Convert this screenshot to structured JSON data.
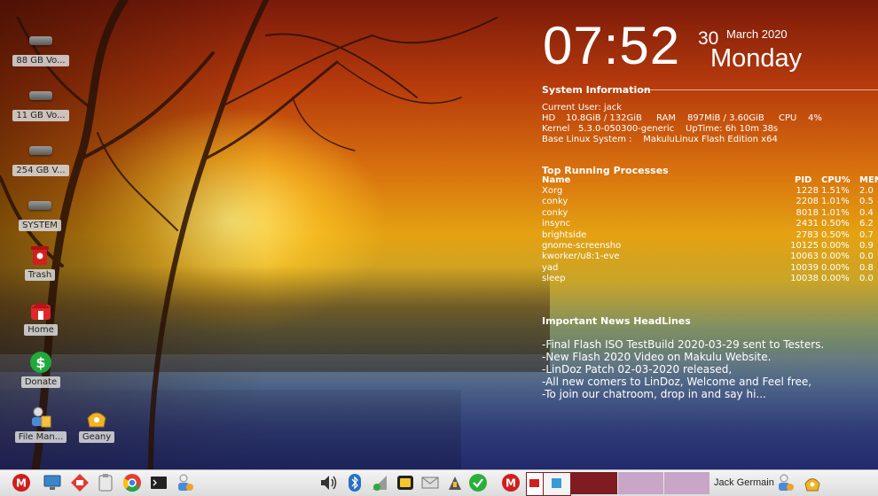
{
  "desktop": {
    "icons": [
      {
        "label": "88 GB Vo...",
        "icon": "drive-icon"
      },
      {
        "label": "11 GB Vo...",
        "icon": "drive-icon"
      },
      {
        "label": "254 GB V...",
        "icon": "drive-icon"
      },
      {
        "label": "SYSTEM",
        "icon": "drive-icon"
      },
      {
        "label": "Trash",
        "icon": "trash-icon"
      },
      {
        "label": "Home",
        "icon": "home-icon"
      },
      {
        "label": "Donate",
        "icon": "dollar-icon"
      },
      {
        "label": "File Man...",
        "icon": "file-manager-icon"
      },
      {
        "label": "Geany",
        "icon": "geany-icon"
      }
    ]
  },
  "conky": {
    "clock": {
      "time": "07:52",
      "day": "30",
      "month_year": "March 2020",
      "weekday": "Monday"
    },
    "system": {
      "title": "System Information",
      "user_line": "Current User: jack",
      "hd_label": "HD",
      "hd_value": "10.8GiB / 132GiB",
      "ram_label": "RAM",
      "ram_value": "897MiB / 3.60GiB",
      "cpu_label": "CPU",
      "cpu_value": "4%",
      "kernel_line": "Kernel   5.3.0-050300-generic",
      "uptime_line": "UpTime: 6h 10m 38s",
      "base_line": "Base Linux System :    MakuluLinux Flash Edition x64"
    },
    "processes": {
      "title": "Top Running Processes",
      "headers": {
        "name": "Name",
        "pid": "PID",
        "cpu": "CPU%",
        "mem": "MEM"
      },
      "rows": [
        {
          "name": "Xorg",
          "pid": "1228",
          "cpu": "1.51%",
          "mem": "2.0"
        },
        {
          "name": "conky",
          "pid": "2208",
          "cpu": "1.01%",
          "mem": "0.5"
        },
        {
          "name": "conky",
          "pid": "8018",
          "cpu": "1.01%",
          "mem": "0.4"
        },
        {
          "name": "insync",
          "pid": "2431",
          "cpu": "0.50%",
          "mem": "6.2"
        },
        {
          "name": "brightside",
          "pid": "2783",
          "cpu": "0.50%",
          "mem": "0.7"
        },
        {
          "name": "gnome-screensho",
          "pid": "10125",
          "cpu": "0.00%",
          "mem": "0.9"
        },
        {
          "name": "kworker/u8:1-eve",
          "pid": "10063",
          "cpu": "0.00%",
          "mem": "0.0"
        },
        {
          "name": "yad",
          "pid": "10039",
          "cpu": "0.00%",
          "mem": "0.8"
        },
        {
          "name": "sleep",
          "pid": "10038",
          "cpu": "0.00%",
          "mem": "0.0"
        }
      ]
    },
    "news": {
      "title": "Important News HeadLines",
      "items": [
        "-Final Flash ISO TestBuild 2020-03-29 sent to Testers.",
        "-New Flash 2020 Video on Makulu Website.",
        "-LinDoz Patch 02-03-2020 released,",
        "-All new comers to LinDoz, Welcome and Feel free,",
        "-To join our chatroom, drop in and say hi..."
      ]
    }
  },
  "taskbar": {
    "username": "Jack Germain",
    "launchers": [
      "makulu-menu-icon",
      "monitor-icon",
      "diamond-app-icon",
      "clipboard-icon",
      "chrome-icon",
      "terminal-icon",
      "user-settings-icon"
    ],
    "tray": [
      "volume-icon",
      "bluetooth-icon",
      "network-icon",
      "notes-icon",
      "mail-icon",
      "updates-icon",
      "check-icon",
      "makulu-icon"
    ],
    "colors": {
      "window_button_1": "#7e1c22",
      "window_button_2": "#c8a6c8",
      "window_button_3": "#c8a6c8"
    }
  }
}
